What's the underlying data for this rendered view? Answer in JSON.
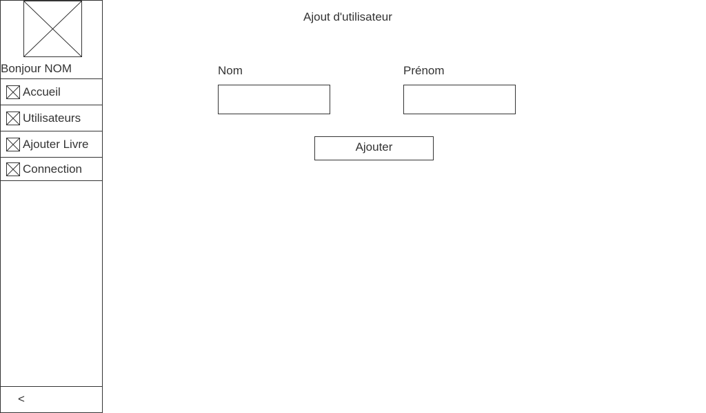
{
  "sidebar": {
    "logo_icon": "image-placeholder-icon",
    "greeting": "Bonjour NOM",
    "items": [
      {
        "label": "Accueil",
        "icon": "image-placeholder-icon"
      },
      {
        "label": "Utilisateurs",
        "icon": "image-placeholder-icon"
      },
      {
        "label": "Ajouter Livre",
        "icon": "image-placeholder-icon"
      },
      {
        "label": "Connection",
        "icon": "image-placeholder-icon"
      }
    ],
    "collapse_label": "<"
  },
  "main": {
    "title": "Ajout d'utilisateur",
    "form": {
      "nom_label": "Nom",
      "nom_value": "",
      "prenom_label": "Prénom",
      "prenom_value": "",
      "submit_label": "Ajouter"
    }
  },
  "colors": {
    "border": "#333333",
    "text": "#333333",
    "background": "#ffffff"
  }
}
